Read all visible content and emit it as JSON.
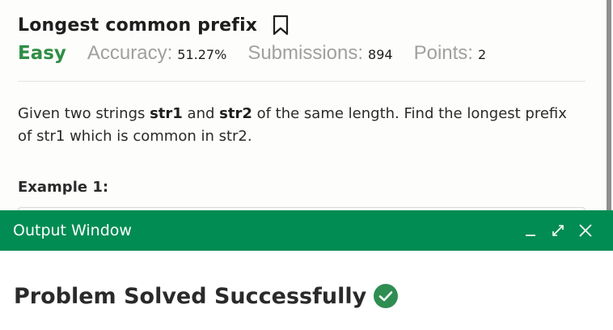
{
  "problem": {
    "title": "Longest common prefix",
    "difficulty": "Easy",
    "accuracy_label": "Accuracy:",
    "accuracy_value": "51.27%",
    "submissions_label": "Submissions:",
    "submissions_value": "894",
    "points_label": "Points:",
    "points_value": "2",
    "description": {
      "part1": "Given two strings ",
      "str1": "str1",
      "part2": " and ",
      "str2": "str2",
      "part3": " of the same length. Find the longest prefix of str1 which is common in str2."
    },
    "example_heading": "Example 1:"
  },
  "output_window": {
    "title": "Output Window",
    "result": "Problem Solved Successfully"
  },
  "icons": {
    "bookmark": "bookmark-icon",
    "minimize": "minimize-icon",
    "expand": "expand-icon",
    "close": "close-icon",
    "success": "check-circle-icon"
  },
  "colors": {
    "accent_green": "#008c52",
    "difficulty_green": "#2f8d46",
    "muted_gray": "#a0a0a0"
  }
}
